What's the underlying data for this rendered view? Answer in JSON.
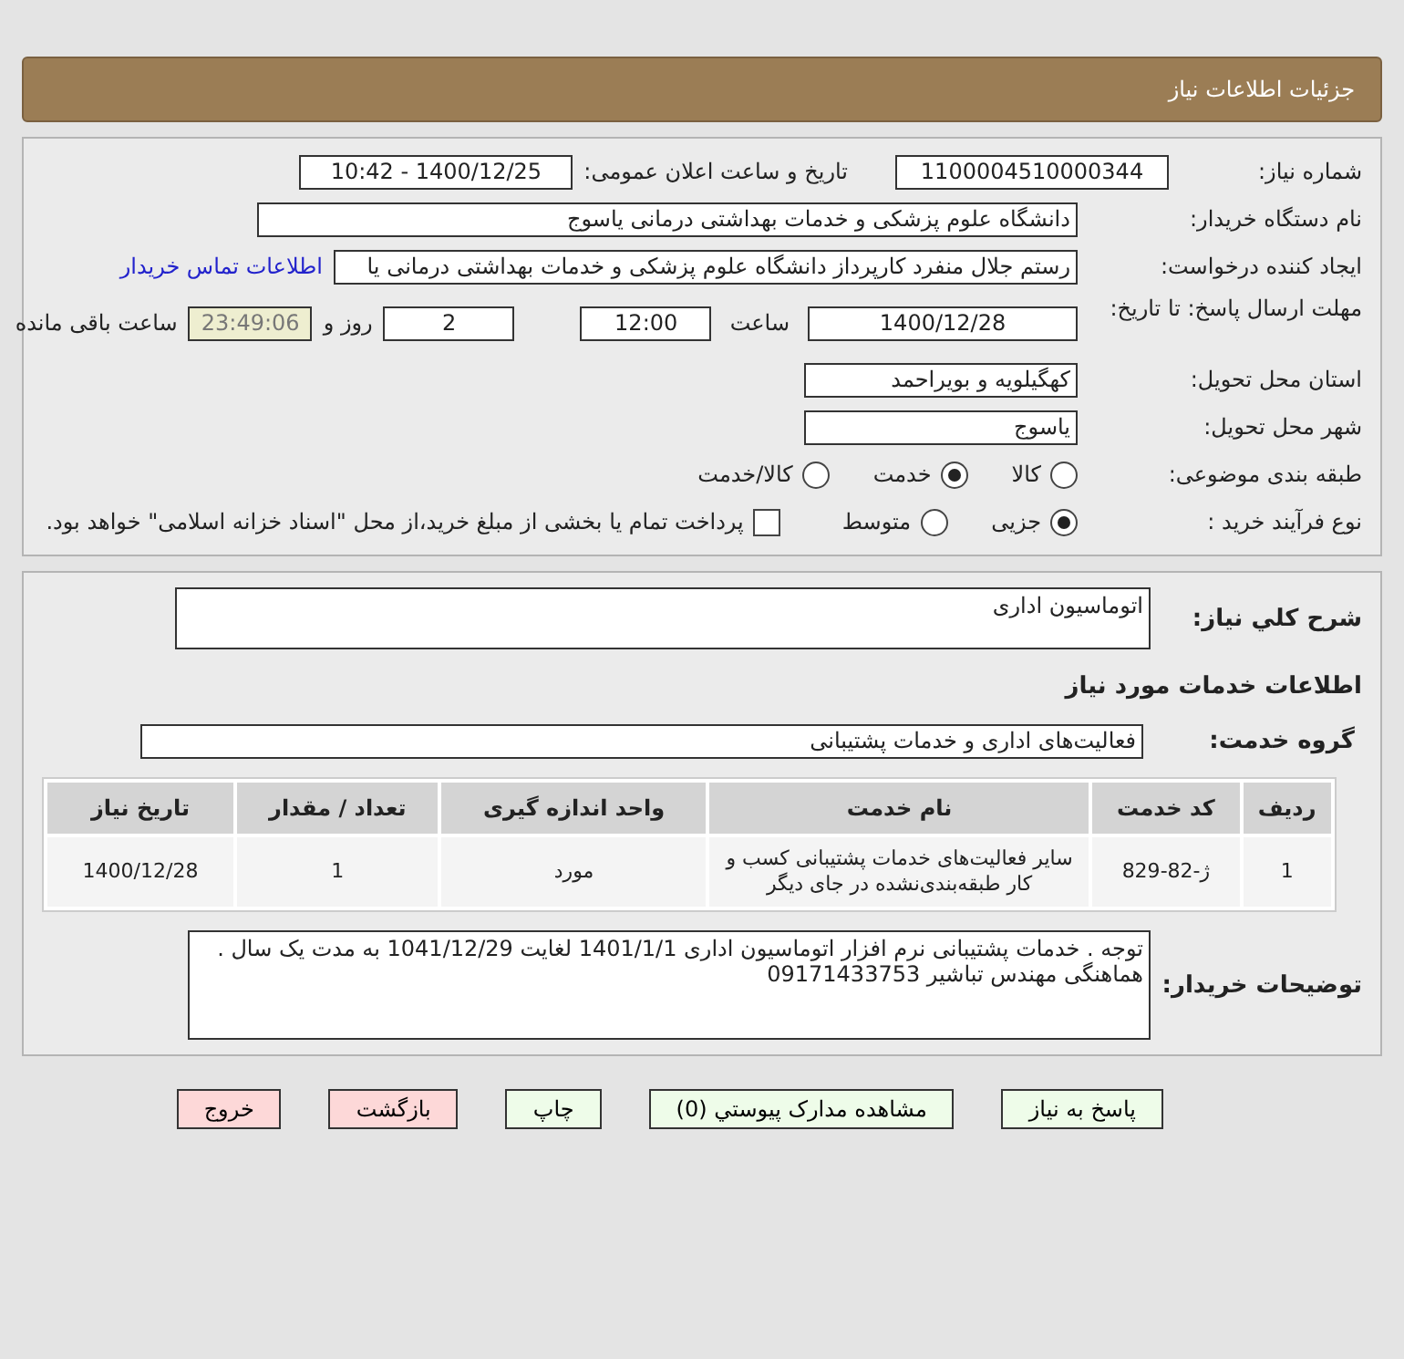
{
  "header": {
    "title": "جزئیات اطلاعات نیاز"
  },
  "need_number": {
    "label": "شماره نیاز:",
    "value": "1100004510000344"
  },
  "announce": {
    "label": "تاریخ و ساعت اعلان عمومی:",
    "value": "1400/12/25 - 10:42"
  },
  "buyer": {
    "label": "نام دستگاه خریدار:",
    "value": "دانشگاه علوم پزشکی و خدمات بهداشتی  درمانی یاسوج"
  },
  "creator": {
    "label": "ایجاد کننده درخواست:",
    "value": "رستم جلال منفرد کارپرداز دانشگاه علوم پزشکی و خدمات بهداشتی  درمانی یا",
    "link": "اطلاعات تماس خریدار"
  },
  "deadline": {
    "label": "مهلت ارسال پاسخ: تا تاریخ:",
    "date": "1400/12/28",
    "time_label": "ساعت",
    "time": "12:00",
    "days": "2",
    "days_label": "روز و",
    "remaining": "23:49:06",
    "remaining_label": "ساعت باقی مانده"
  },
  "province": {
    "label": "استان محل تحویل:",
    "value": "کهگیلویه و بویراحمد"
  },
  "city": {
    "label": "شهر محل تحویل:",
    "value": "یاسوج"
  },
  "category": {
    "label": "طبقه بندی موضوعی:",
    "options": [
      {
        "label": "کالا",
        "selected": false
      },
      {
        "label": "خدمت",
        "selected": true
      },
      {
        "label": "کالا/خدمت",
        "selected": false
      }
    ]
  },
  "process": {
    "label": "نوع فرآیند خرید :",
    "options": [
      {
        "label": "جزیی",
        "selected": true
      },
      {
        "label": "متوسط",
        "selected": false
      }
    ],
    "treasury": {
      "label": "پرداخت تمام یا بخشی از مبلغ خرید،از محل \"اسناد خزانه اسلامی\" خواهد بود.",
      "checked": false
    }
  },
  "description": {
    "label": "شرح کلي نیاز:",
    "value": "اتوماسیون اداری"
  },
  "services_heading": "اطلاعات خدمات مورد نیاز",
  "service_group": {
    "label": "گروه خدمت:",
    "value": "فعالیت‌های اداری و خدمات پشتیبانی"
  },
  "table": {
    "columns": [
      "ردیف",
      "کد خدمت",
      "نام خدمت",
      "واحد اندازه گیری",
      "تعداد / مقدار",
      "تاریخ نیاز"
    ],
    "rows": [
      [
        "1",
        "ژ-82-829",
        "سایر فعالیت‌های خدمات پشتیبانی کسب و کار طبقه‌بندی‌نشده در جای دیگر",
        "مورد",
        "1",
        "1400/12/28"
      ]
    ]
  },
  "buyer_notes": {
    "label": "توضیحات خریدار:",
    "lines": [
      "توجه . خدمات پشتیبانی نرم افزار اتوماسیون اداری 1401/1/1 لغایت 1041/12/29 به مدت یک سال .",
      "هماهنگی مهندس تباشیر 09171433753"
    ]
  },
  "buttons": [
    {
      "label": "پاسخ به نیاز",
      "kind": "normal"
    },
    {
      "label": "مشاهده مدارک پیوستي (0)",
      "kind": "normal"
    },
    {
      "label": "چاپ",
      "kind": "normal"
    },
    {
      "label": "بازگشت",
      "kind": "danger"
    },
    {
      "label": "خروج",
      "kind": "danger"
    }
  ]
}
